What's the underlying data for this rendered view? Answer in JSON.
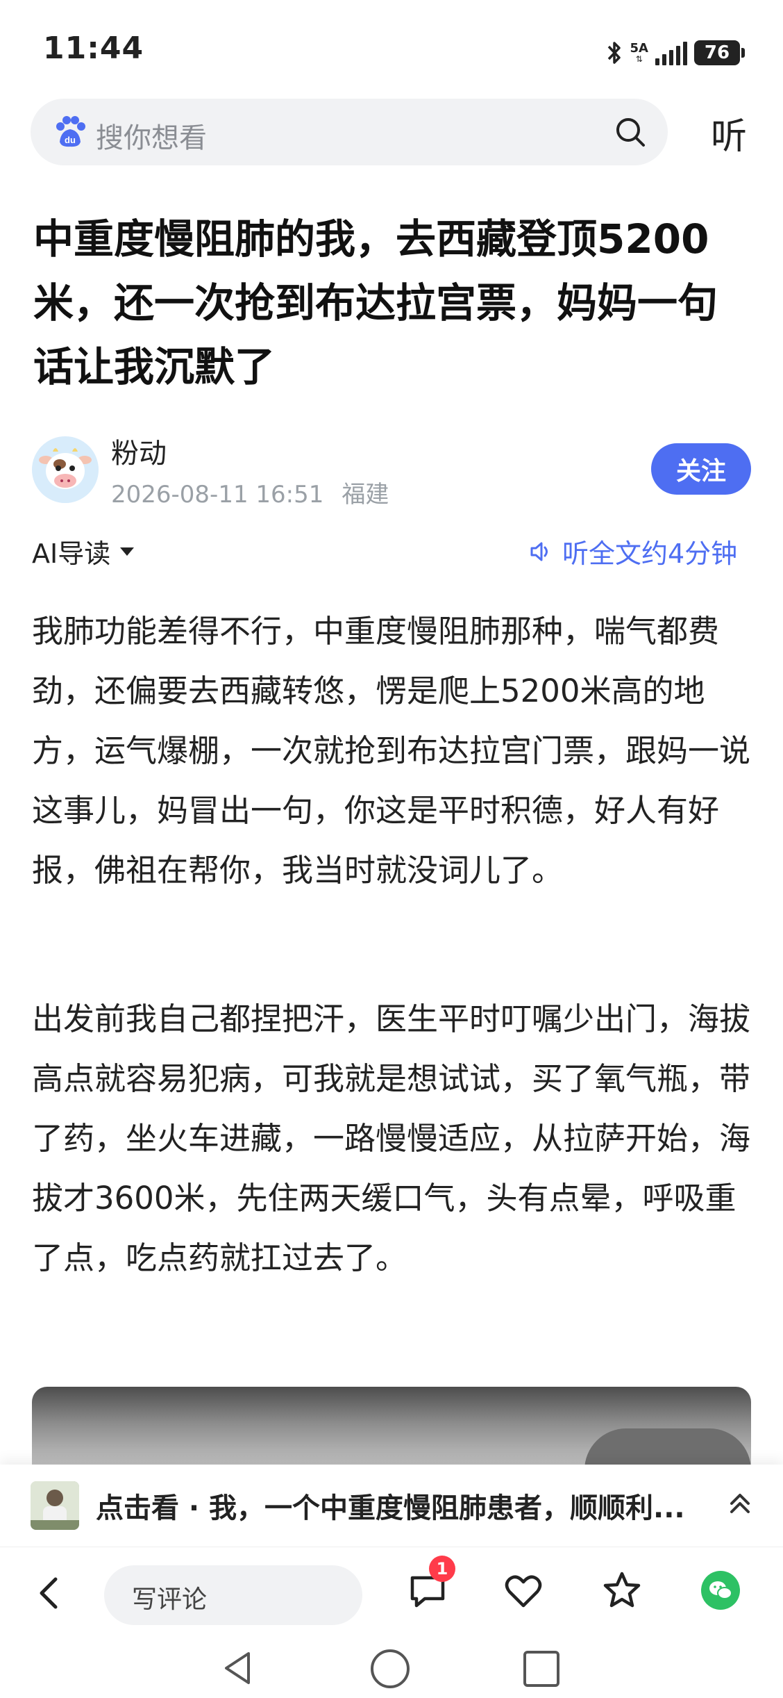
{
  "status": {
    "time": "11:44",
    "network": "5A",
    "battery": "76"
  },
  "search": {
    "placeholder": "搜你想看",
    "listen_label": "听"
  },
  "article": {
    "title": "中重度慢阻肺的我，去西藏登顶5200米，还一次抢到布达拉宫票，妈妈一句话让我沉默了",
    "author": "粉动",
    "datetime": "2026-08-11 16:51",
    "location": "福建",
    "follow_label": "关注",
    "ai_guide": "AI导读",
    "listen_full": "听全文约4分钟",
    "paragraphs": [
      "我肺功能差得不行，中重度慢阻肺那种，喘气都费劲，还偏要去西藏转悠，愣是爬上5200米高的地方，运气爆棚，一次就抢到布达拉宫门票，跟妈一说这事儿，妈冒出一句，你这是平时积德，好人有好报，佛祖在帮你，我当时就没词儿了。",
      "出发前我自己都捏把汗，医生平时叮嘱少出门，海拔高点就容易犯病，可我就是想试试，买了氧气瓶，带了药，坐火车进藏，一路慢慢适应，从拉萨开始，海拔才3600米，先住两天缓口气，头有点晕，呼吸重了点，吃点药就扛过去了。"
    ]
  },
  "recommendation": {
    "text": "点击看 · 我，一个中重度慢阻肺患者，顺顺利..."
  },
  "bottom_bar": {
    "comment_placeholder": "写评论",
    "comment_badge": "1"
  },
  "colors": {
    "accent": "#4e6ef2",
    "badge": "#ff3b4a",
    "wechat": "#2dc164"
  }
}
